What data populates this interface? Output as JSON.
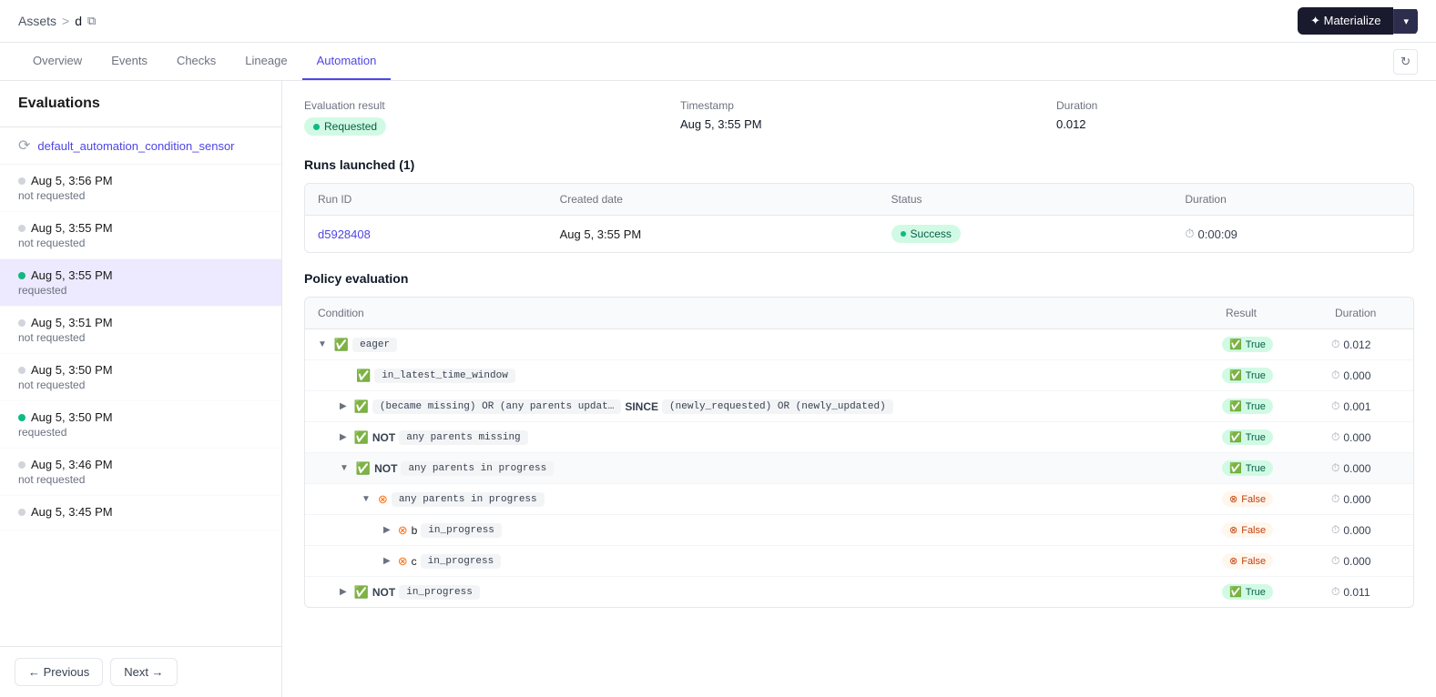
{
  "breadcrumb": {
    "assets": "Assets",
    "sep": ">",
    "current": "d"
  },
  "materialize_btn": {
    "label": "✦ Materialize",
    "arrow": "▾"
  },
  "tabs": [
    {
      "id": "overview",
      "label": "Overview"
    },
    {
      "id": "events",
      "label": "Events"
    },
    {
      "id": "checks",
      "label": "Checks"
    },
    {
      "id": "lineage",
      "label": "Lineage"
    },
    {
      "id": "automation",
      "label": "Automation",
      "active": true
    }
  ],
  "sidebar": {
    "title": "Evaluations",
    "sensor": {
      "label": "default_automation_condition_sensor"
    },
    "evaluations": [
      {
        "time": "Aug 5, 3:56 PM",
        "status": "not requested",
        "dot": "gray",
        "active": false
      },
      {
        "time": "Aug 5, 3:55 PM",
        "status": "not requested",
        "dot": "gray",
        "active": false
      },
      {
        "time": "Aug 5, 3:55 PM",
        "status": "requested",
        "dot": "green",
        "active": true
      },
      {
        "time": "Aug 5, 3:51 PM",
        "status": "not requested",
        "dot": "gray",
        "active": false
      },
      {
        "time": "Aug 5, 3:50 PM",
        "status": "not requested",
        "dot": "gray",
        "active": false
      },
      {
        "time": "Aug 5, 3:50 PM",
        "status": "requested",
        "dot": "green",
        "active": false
      },
      {
        "time": "Aug 5, 3:46 PM",
        "status": "not requested",
        "dot": "gray",
        "active": false
      },
      {
        "time": "Aug 5, 3:45 PM",
        "status": "",
        "dot": "gray",
        "active": false
      }
    ],
    "prev_btn": "← Previous",
    "next_btn": "Next →"
  },
  "eval_result": {
    "title": "Evaluation result",
    "result_label": "Evaluation result",
    "result_value": "Requested",
    "timestamp_label": "Timestamp",
    "timestamp_value": "Aug 5, 3:55 PM",
    "duration_label": "Duration",
    "duration_value": "0.012"
  },
  "runs_launched": {
    "title": "Runs launched (1)",
    "columns": [
      "Run ID",
      "Created date",
      "Status",
      "Duration"
    ],
    "rows": [
      {
        "run_id": "d5928408",
        "created_date": "Aug 5, 3:55 PM",
        "status": "Success",
        "duration": "0:00:09"
      }
    ]
  },
  "policy_evaluation": {
    "title": "Policy evaluation",
    "columns": [
      "Condition",
      "Result",
      "Duration"
    ],
    "rows": [
      {
        "indent": 0,
        "expand": "▼",
        "icon": "check",
        "parts": [
          {
            "type": "pill",
            "text": "eager"
          }
        ],
        "result": "True",
        "result_type": "true",
        "duration": "0.012"
      },
      {
        "indent": 1,
        "expand": "",
        "icon": "check",
        "parts": [
          {
            "type": "pill",
            "text": "in_latest_time_window"
          }
        ],
        "result": "True",
        "result_type": "true",
        "duration": "0.000"
      },
      {
        "indent": 1,
        "expand": "▶",
        "icon": "check",
        "parts": [
          {
            "type": "pill",
            "text": "(became missing) OR (any parents updat…"
          },
          {
            "type": "keyword",
            "text": "SINCE"
          },
          {
            "type": "pill",
            "text": "(newly_requested) OR (newly_updated)"
          }
        ],
        "result": "True",
        "result_type": "true",
        "duration": "0.001",
        "highlighted": false
      },
      {
        "indent": 1,
        "expand": "▶",
        "icon": "check",
        "parts": [
          {
            "type": "keyword-not",
            "text": "NOT"
          },
          {
            "type": "pill",
            "text": "any parents missing"
          }
        ],
        "result": "True",
        "result_type": "true",
        "duration": "0.000"
      },
      {
        "indent": 1,
        "expand": "▼",
        "icon": "check",
        "parts": [
          {
            "type": "keyword-not",
            "text": "NOT"
          },
          {
            "type": "pill",
            "text": "any parents in progress"
          }
        ],
        "result": "True",
        "result_type": "true",
        "duration": "0.000",
        "highlighted": true
      },
      {
        "indent": 2,
        "expand": "▼",
        "icon": "x",
        "parts": [
          {
            "type": "pill",
            "text": "any parents in progress"
          }
        ],
        "result": "False",
        "result_type": "false",
        "duration": "0.000"
      },
      {
        "indent": 3,
        "expand": "▶",
        "icon": "x",
        "parts": [
          {
            "type": "letter",
            "text": "b"
          },
          {
            "type": "pill",
            "text": "in_progress"
          }
        ],
        "result": "False",
        "result_type": "false",
        "duration": "0.000"
      },
      {
        "indent": 3,
        "expand": "▶",
        "icon": "x",
        "parts": [
          {
            "type": "letter",
            "text": "c"
          },
          {
            "type": "pill",
            "text": "in_progress"
          }
        ],
        "result": "False",
        "result_type": "false",
        "duration": "0.000"
      },
      {
        "indent": 1,
        "expand": "▶",
        "icon": "check",
        "parts": [
          {
            "type": "keyword-not",
            "text": "NOT"
          },
          {
            "type": "pill",
            "text": "in_progress"
          }
        ],
        "result": "True",
        "result_type": "true",
        "duration": "0.011"
      }
    ]
  }
}
